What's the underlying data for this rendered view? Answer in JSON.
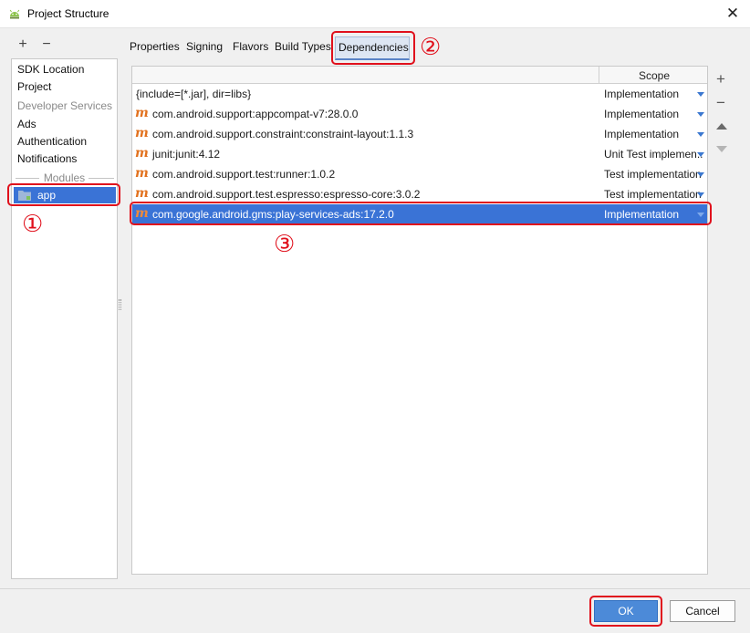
{
  "window": {
    "title": "Project Structure",
    "close_glyph": "✕"
  },
  "left_panel": {
    "add_glyph": "+",
    "remove_glyph": "−",
    "items": [
      {
        "label": "SDK Location"
      },
      {
        "label": "Project"
      }
    ],
    "developer_services_header": "Developer Services",
    "developer_services": [
      {
        "label": "Ads"
      },
      {
        "label": "Authentication"
      },
      {
        "label": "Notifications"
      }
    ],
    "modules_header": "Modules",
    "modules": [
      {
        "label": "app",
        "icon": "module-folder-icon",
        "selected": true
      }
    ]
  },
  "tabs": [
    {
      "label": "Properties"
    },
    {
      "label": "Signing"
    },
    {
      "label": "Flavors"
    },
    {
      "label": "Build Types"
    },
    {
      "label": "Dependencies",
      "active": true
    }
  ],
  "table": {
    "columns": [
      "",
      "Scope"
    ],
    "rows": [
      {
        "name": "{include=[*.jar], dir=libs}",
        "scope": "Implementation",
        "maven_icon": false
      },
      {
        "name": "com.android.support:appcompat-v7:28.0.0",
        "scope": "Implementation",
        "maven_icon": true
      },
      {
        "name": "com.android.support.constraint:constraint-layout:1.1.3",
        "scope": "Implementation",
        "maven_icon": true
      },
      {
        "name": "junit:junit:4.12",
        "scope": "Unit Test implemen...",
        "maven_icon": true
      },
      {
        "name": "com.android.support.test:runner:1.0.2",
        "scope": "Test implementation",
        "maven_icon": true
      },
      {
        "name": "com.android.support.test.espresso:espresso-core:3.0.2",
        "scope": "Test implementation",
        "maven_icon": true
      },
      {
        "name": "com.google.android.gms:play-services-ads:17.2.0",
        "scope": "Implementation",
        "maven_icon": true,
        "selected": true
      }
    ]
  },
  "right_toolbar": {
    "add_glyph": "+",
    "remove_glyph": "−"
  },
  "buttons": {
    "ok": "OK",
    "cancel": "Cancel"
  },
  "annotations": {
    "one": "①",
    "two": "②",
    "three": "③",
    "color": "#e0101c"
  },
  "colors": {
    "selection": "#3a73d6",
    "maven_icon": "#e2711d",
    "ok_button": "#4c8ad8"
  }
}
